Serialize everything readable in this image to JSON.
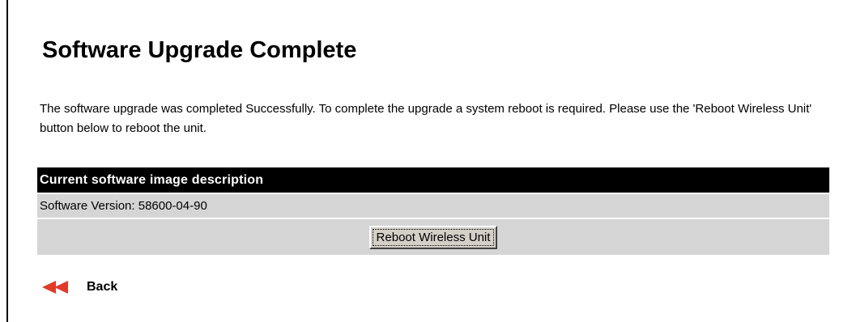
{
  "page": {
    "title": "Software Upgrade Complete",
    "message": "The software upgrade was completed Successfully. To complete the upgrade a system reboot is required. Please use the 'Reboot Wireless Unit' button below to reboot the unit."
  },
  "image_info": {
    "header": "Current software image description",
    "version_text": "Software Version: 58600-04-90"
  },
  "actions": {
    "reboot_label": "Reboot Wireless Unit",
    "back_label": "Back",
    "back_icon": "double-left-arrow-icon"
  },
  "colors": {
    "header_bg": "#000000",
    "row_bg": "#d5d5d5",
    "back_arrow": "#e03a2a"
  }
}
